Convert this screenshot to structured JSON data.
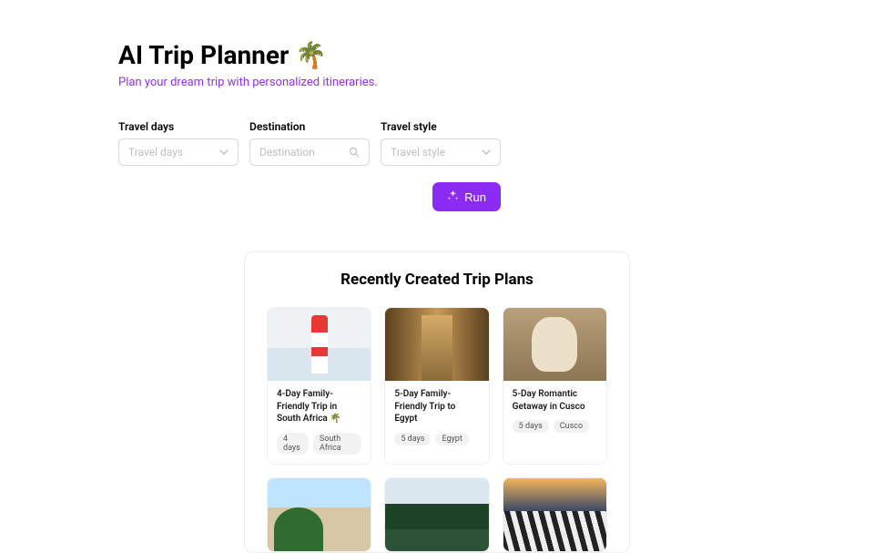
{
  "header": {
    "title": "AI Trip Planner 🌴",
    "subtitle": "Plan your dream trip with personalized itineraries."
  },
  "form": {
    "travel_days": {
      "label": "Travel days",
      "placeholder": "Travel days"
    },
    "destination": {
      "label": "Destination",
      "placeholder": "Destination"
    },
    "travel_style": {
      "label": "Travel style",
      "placeholder": "Travel style"
    },
    "run_label": "Run"
  },
  "recent": {
    "title": "Recently Created Trip Plans",
    "cards": [
      {
        "title": "4-Day Family-Friendly Trip in South Africa 🌴",
        "days": "4 days",
        "place": "South Africa"
      },
      {
        "title": "5-Day Family-Friendly Trip to Egypt",
        "days": "5 days",
        "place": "Egypt"
      },
      {
        "title": "5-Day Romantic Getaway in Cusco",
        "days": "5 days",
        "place": "Cusco"
      }
    ]
  }
}
